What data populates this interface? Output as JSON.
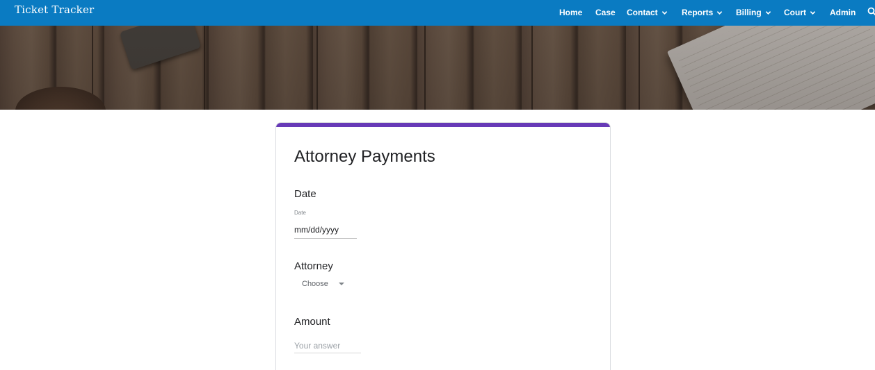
{
  "app": {
    "brand": "Ticket Tracker"
  },
  "nav": {
    "items": [
      {
        "label": "Home",
        "dropdown": false
      },
      {
        "label": "Case",
        "dropdown": false
      },
      {
        "label": "Contact",
        "dropdown": true
      },
      {
        "label": "Reports",
        "dropdown": true
      },
      {
        "label": "Billing",
        "dropdown": true
      },
      {
        "label": "Court",
        "dropdown": true
      },
      {
        "label": "Admin",
        "dropdown": false
      }
    ],
    "search_icon": "search-icon"
  },
  "form": {
    "title": "Attorney Payments",
    "accent_color": "#673ab7",
    "questions": {
      "date": {
        "label": "Date",
        "sublabel": "Date",
        "value": "mm/dd/yyyy"
      },
      "attorney": {
        "label": "Attorney",
        "selected": "Choose"
      },
      "amount": {
        "label": "Amount",
        "placeholder": "Your answer"
      }
    }
  },
  "colors": {
    "topbar": "#0a7bc2",
    "title_text": "#202124"
  }
}
